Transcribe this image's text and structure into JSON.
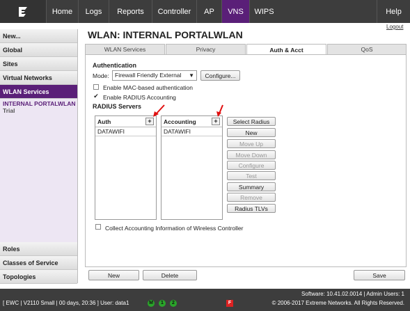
{
  "nav": {
    "tabs": [
      "Home",
      "Logs",
      "Reports",
      "Controller",
      "AP",
      "VNS",
      "WIPS",
      "Help"
    ],
    "logout": "Logout"
  },
  "sidebar": {
    "items": [
      "New...",
      "Global",
      "Sites",
      "Virtual Networks",
      "WLAN Services"
    ],
    "sub_item": "INTERNAL PORTALWLAN",
    "sub_item_note": "Trial",
    "bottom_items": [
      "Roles",
      "Classes of Service",
      "Topologies"
    ]
  },
  "page": {
    "title": "WLAN: INTERNAL PORTALWLAN",
    "tabs": [
      "WLAN Services",
      "Privacy",
      "Auth & Acct",
      "QoS"
    ]
  },
  "auth": {
    "section": "Authentication",
    "mode_label": "Mode:",
    "mode_value": "Firewall Friendly External",
    "configure": "Configure...",
    "mac_auth": "Enable MAC-based authentication",
    "radius_acct": "Enable RADIUS Accounting",
    "radius_servers": "RADIUS Servers",
    "auth_header": "Auth",
    "acct_header": "Accounting",
    "auth_rows": [
      "DATAWIFI"
    ],
    "acct_rows": [
      "DATAWIFI"
    ],
    "plus": "+",
    "buttons": [
      "Select Radius",
      "New",
      "Move Up",
      "Move Down",
      "Configure",
      "Test",
      "Summary",
      "Remove",
      "Radius TLVs"
    ],
    "collect": "Collect Accounting Information of Wireless Controller"
  },
  "actions": {
    "new": "New",
    "delete": "Delete",
    "save": "Save"
  },
  "footer": {
    "software": "Software: 10.41.02.0014 | Admin Users: 1",
    "copyright": "© 2006-2017  Extreme Networks. All Rights Reserved.",
    "status": "[ EWC | V2110 Small | 00 days, 20:36 ]  User: data1",
    "badges": [
      "M",
      "1",
      "2"
    ],
    "alarm": "F"
  }
}
